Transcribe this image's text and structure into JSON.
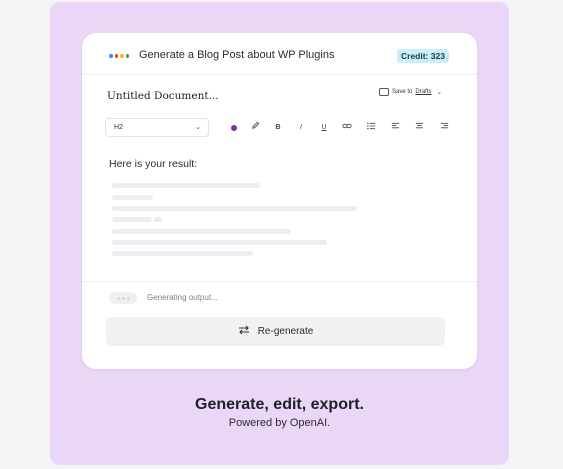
{
  "header": {
    "title": "Generate a Blog Post about WP Plugins",
    "credit": "Credit: 323",
    "dot_colors": [
      "#4285f4",
      "#ea4335",
      "#fbbc05",
      "#34a853"
    ]
  },
  "document": {
    "name": "Untitled Document...",
    "save_prefix": "Save to",
    "save_target": "Drafts"
  },
  "toolbar": {
    "heading_select": "H2",
    "accent_color": "#8a27b8",
    "tools": [
      "color-dot",
      "pen-icon",
      "bold-icon",
      "italic-icon",
      "underline-icon",
      "link-icon",
      "list-icon",
      "align-left-icon",
      "align-center-icon",
      "align-right-icon"
    ]
  },
  "content": {
    "result_heading": "Here is your result:"
  },
  "status": {
    "generating": "Generating output..."
  },
  "actions": {
    "regenerate": "Re-generate"
  },
  "caption": {
    "headline": "Generate, edit, export.",
    "subline": "Powered by OpenAI."
  }
}
